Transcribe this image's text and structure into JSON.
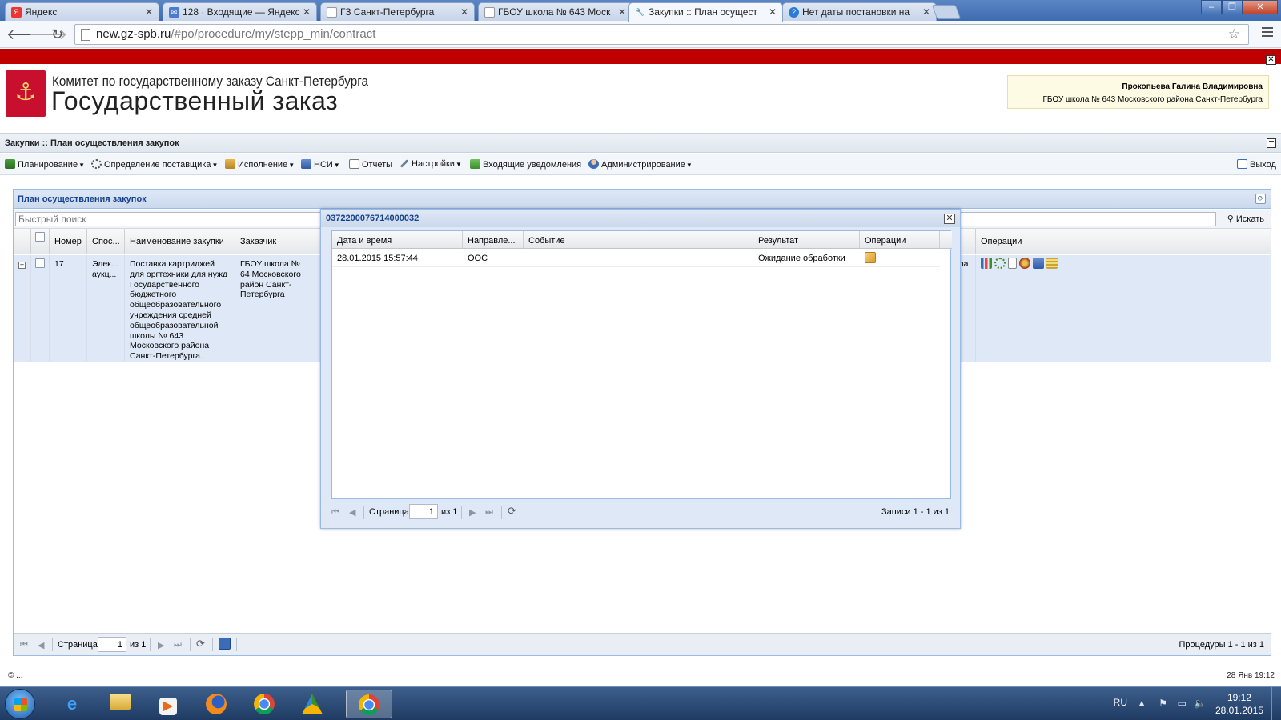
{
  "browser": {
    "tabs": [
      {
        "title": "Яндекс",
        "icon": "yandex-icon",
        "color": "#e33"
      },
      {
        "title": "128 · Входящие — Яндекс",
        "icon": "mail-icon",
        "color": "#4a7bd0"
      },
      {
        "title": "ГЗ Санкт-Петербурга",
        "icon": "page-icon",
        "color": "#aaa"
      },
      {
        "title": "ГБОУ школа № 643 Моск",
        "icon": "page-icon",
        "color": "#aaa"
      },
      {
        "title": "Закупки :: План осущест",
        "icon": "tools-icon",
        "color": "#888"
      },
      {
        "title": "Нет даты постановки на",
        "icon": "globe-icon",
        "color": "#2a7bd6"
      }
    ],
    "url_host": "new.gz-spb.ru",
    "url_path": "/#po/procedure/my/stepp_min/contract"
  },
  "header": {
    "subtitle": "Комитет по государственному заказу Санкт-Петербурга",
    "title": "Государственный заказ",
    "user_name": "Прокопьева Галина Владимировна",
    "user_org": "ГБОУ школа № 643 Московского района Санкт-Петербурга"
  },
  "module_title": "Закупки :: План осуществления закупок",
  "menu": {
    "items": [
      "Планирование",
      "Определение поставщика",
      "Исполнение",
      "НСИ",
      "Отчеты",
      "Настройки",
      "Входящие уведомления",
      "Администрирование"
    ],
    "logout": "Выход"
  },
  "grid": {
    "title": "План осуществления закупок",
    "search_placeholder": "Быстрый поиск",
    "search_button": "Искать",
    "columns": {
      "number": "Номер",
      "method": "Спос...",
      "name": "Наименование закупки",
      "customer": "Заказчик",
      "status": "тус",
      "operations": "Операции"
    },
    "rows": [
      {
        "number": "17",
        "method": "Элек... аукц...",
        "name": "Поставка картриджей для оргтехники для нужд Государственного бюджетного общеобразовательного учреждения средней общеобразовательной школы № 643 Московского района Санкт-Петербурга.",
        "customer": "ГБОУ школа № 64 Московского район Санкт-Петербурга",
        "status": "говора"
      }
    ],
    "pager": {
      "page_label": "Страница",
      "page_value": "1",
      "of_label": "из 1",
      "summary": "Процедуры 1 - 1 из 1"
    }
  },
  "modal": {
    "title": "0372200076714000032",
    "columns": {
      "datetime": "Дата и время",
      "direction": "Направле...",
      "event": "Событие",
      "result": "Результат",
      "operations": "Операции"
    },
    "rows": [
      {
        "datetime": "28.01.2015 15:57:44",
        "direction": "ООС",
        "event": "",
        "result": "Ожидание обработки"
      }
    ],
    "pager": {
      "page_label": "Страница",
      "page_value": "1",
      "of_label": "из 1",
      "summary": "Записи 1 - 1 из 1"
    }
  },
  "footer": {
    "left": "© ...",
    "right": "28 Янв 19:12"
  },
  "taskbar": {
    "lang": "RU",
    "time": "19:12",
    "date": "28.01.2015"
  },
  "colors": {
    "accent_red": "#c00000",
    "panel_blue": "#99bbe8",
    "row_selected": "#dfe8f6"
  }
}
